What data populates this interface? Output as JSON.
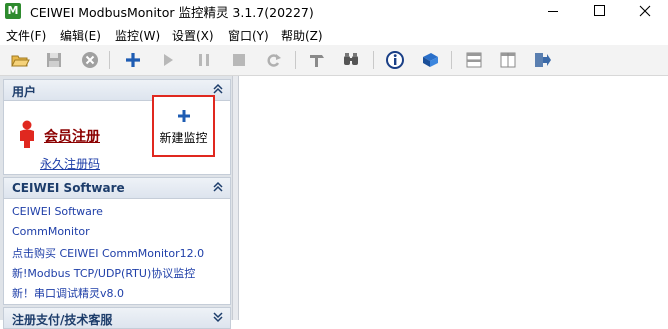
{
  "window": {
    "app_icon_letter": "M",
    "title": "CEIWEI ModbusMonitor 监控精灵 3.1.7(20227)"
  },
  "menu": [
    {
      "label": "文件(F)"
    },
    {
      "label": "编辑(E)"
    },
    {
      "label": "监控(W)"
    },
    {
      "label": "设置(X)"
    },
    {
      "label": "窗口(Y)"
    },
    {
      "label": "帮助(Z)"
    }
  ],
  "toolbar_icons": [
    "open-folder-icon",
    "save-icon",
    "delete-icon",
    "add-icon",
    "start-icon",
    "pause-icon",
    "stop-icon",
    "refresh-icon",
    "tools-icon",
    "find-icon",
    "info-icon",
    "book-icon",
    "split-horizontal-icon",
    "split-vertical-icon",
    "exit-icon"
  ],
  "user_panel": {
    "title": "用户",
    "register_link": "会员注册",
    "permanent_code_link": "永久注册码",
    "new_monitor_label": "新建监控"
  },
  "software_panel": {
    "title": "CEIWEI Software",
    "links": [
      "CEIWEI Software",
      "CommMonitor",
      "点击购买 CEIWEI CommMonitor12.0",
      "新!Modbus TCP/UDP(RTU)协议监控",
      "新！串口调试精灵v8.0"
    ]
  },
  "support_panel": {
    "title": "注册支付/技术客服"
  },
  "colors": {
    "accent_red": "#e0281f",
    "link_blue": "#1f3fa8",
    "panel_title": "#1d3d6b"
  }
}
